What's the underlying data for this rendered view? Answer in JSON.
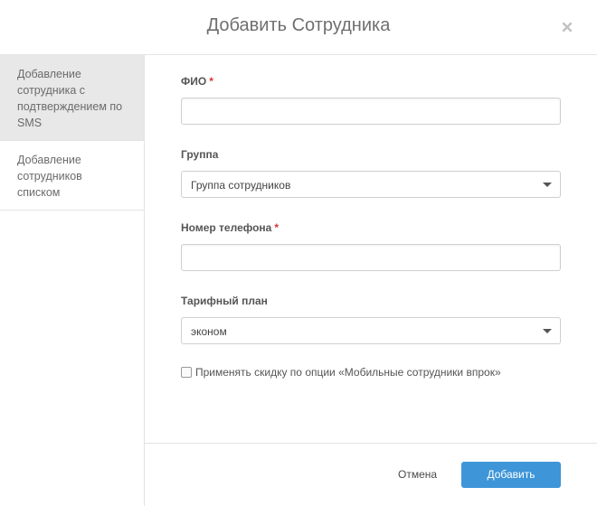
{
  "dialog": {
    "title": "Добавить Сотрудника",
    "close_icon": "close-icon"
  },
  "sidebar": {
    "items": [
      {
        "label": "Добавление сотрудника с подтверждением по SMS",
        "active": true
      },
      {
        "label": "Добавление сотрудников списком",
        "active": false
      }
    ]
  },
  "form": {
    "fio": {
      "label": "ФИО",
      "required_mark": "*",
      "value": ""
    },
    "group": {
      "label": "Группа",
      "selected": "Группа сотрудников"
    },
    "phone": {
      "label": "Номер телефона",
      "required_mark": "*",
      "value": ""
    },
    "tariff": {
      "label": "Тарифный план",
      "selected": "эконом"
    },
    "discount_checkbox": {
      "label": "Применять скидку по опции «Мобильные сотрудники впрок»",
      "checked": false
    }
  },
  "footer": {
    "cancel_label": "Отмена",
    "submit_label": "Добавить"
  },
  "colors": {
    "accent": "#3e95d8",
    "required": "#d9343a",
    "sidebar_active": "#e8e8e8"
  }
}
